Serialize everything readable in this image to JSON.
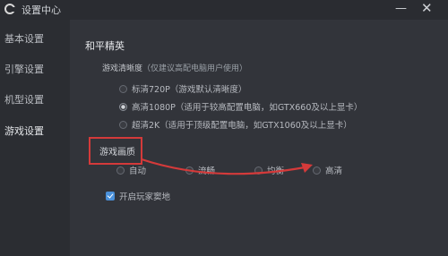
{
  "window": {
    "title": "设置中心",
    "min_glyph": "—",
    "close_glyph": "✕"
  },
  "sidebar": {
    "items": [
      {
        "label": "基本设置"
      },
      {
        "label": "引擎设置"
      },
      {
        "label": "机型设置"
      },
      {
        "label": "游戏设置",
        "active": true
      }
    ]
  },
  "main": {
    "game_title": "和平精英",
    "resolution": {
      "heading": "游戏清晰度",
      "hint": "（仅建议高配电脑用户使用）",
      "options": [
        {
          "label": "标清720P（游戏默认清晰度）",
          "selected": false
        },
        {
          "label": "高清1080P（适用于较高配置电脑，如GTX660及以上显卡）",
          "selected": true
        },
        {
          "label": "超清2K（适用于顶级配置电脑，如GTX1060及以上显卡）",
          "selected": false
        }
      ]
    },
    "quality": {
      "heading": "游戏画质",
      "options": [
        {
          "label": "自动"
        },
        {
          "label": "流畅"
        },
        {
          "label": "均衡"
        },
        {
          "label": "高清"
        }
      ]
    },
    "checkbox": {
      "label": "开启玩家窦地",
      "checked": true
    }
  },
  "colors": {
    "annotation": "#d43a3a",
    "accent": "#4a90d9"
  }
}
